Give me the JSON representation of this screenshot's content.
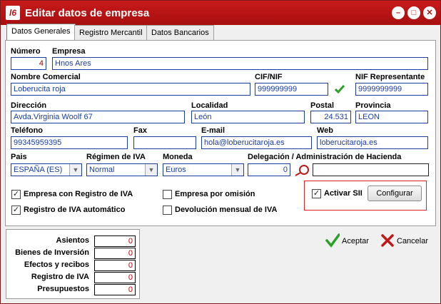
{
  "window": {
    "logo": "l6",
    "title": "Editar datos de empresa",
    "controls": [
      "minimize",
      "restore",
      "close"
    ]
  },
  "tabs": [
    "Datos Generales",
    "Registro Mercantil",
    "Datos Bancarios"
  ],
  "form": {
    "numero": {
      "label": "Número",
      "value": "4"
    },
    "empresa": {
      "label": "Empresa",
      "value": "Hnos Ares"
    },
    "nombre_comercial": {
      "label": "Nombre Comercial",
      "value": "Loberucita roja"
    },
    "cif": {
      "label": "CIF/NIF",
      "value": "999999999"
    },
    "nif_representante": {
      "label": "NIF Representante",
      "value": "9999999999"
    },
    "direccion": {
      "label": "Dirección",
      "value": "Avda.Virginia Woolf 67"
    },
    "localidad": {
      "label": "Localidad",
      "value": "León"
    },
    "postal": {
      "label": "Postal",
      "value": "24.531"
    },
    "provincia": {
      "label": "Provincia",
      "value": "LEON"
    },
    "telefono": {
      "label": "Teléfono",
      "value": "99345959395"
    },
    "fax": {
      "label": "Fax",
      "value": ""
    },
    "email": {
      "label": "E-mail",
      "value": "hola@loberucitaroja.es"
    },
    "web": {
      "label": "Web",
      "value": "loberucitaroja.es"
    },
    "pais": {
      "label": "Pais",
      "value": "ESPAÑA  (ES)"
    },
    "regimen_iva": {
      "label": "Régimen de IVA",
      "value": "Normal"
    },
    "moneda": {
      "label": "Moneda",
      "value": "Euros"
    },
    "delegacion": {
      "label": "Delegación / Administración de Hacienda",
      "value": "0",
      "name": ""
    }
  },
  "checks": {
    "empresa_registro_iva": {
      "label": "Empresa con Registro de IVA",
      "checked": true
    },
    "registro_iva_auto": {
      "label": "Registro de IVA automático",
      "checked": true
    },
    "empresa_omision": {
      "label": "Empresa por omisión",
      "checked": false
    },
    "devolucion_mensual": {
      "label": "Devolución mensual de IVA",
      "checked": false
    },
    "activar_sii": {
      "label": "Activar SII",
      "checked": true
    }
  },
  "configurar_label": "Configurar",
  "counts": [
    {
      "label": "Asientos",
      "value": "0"
    },
    {
      "label": "Bienes de Inversión",
      "value": "0"
    },
    {
      "label": "Efectos y recibos",
      "value": "0"
    },
    {
      "label": "Registro de IVA",
      "value": "0"
    },
    {
      "label": "Presupuestos",
      "value": "0"
    }
  ],
  "actions": {
    "accept_label": "Aceptar",
    "cancel_label": "Cancelar"
  },
  "colors": {
    "titlebar": "#b81414",
    "field_text": "#1a3da6",
    "count_text": "#c00000",
    "accept_icon": "#2aa02a",
    "cancel_icon": "#c01818",
    "sii_highlight": "#e02020"
  }
}
